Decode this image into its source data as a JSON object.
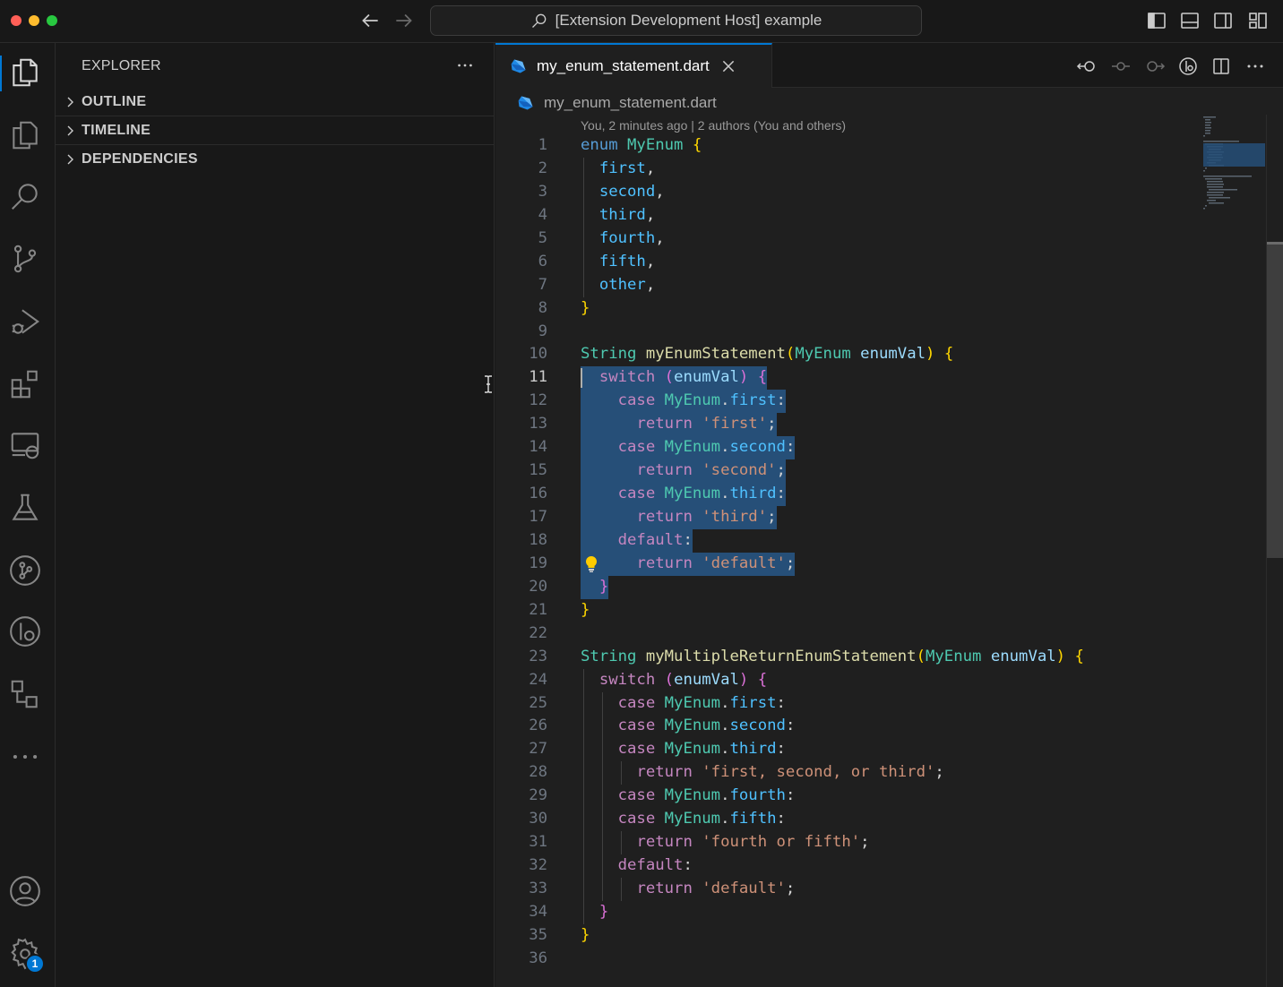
{
  "window": {
    "title": "[Extension Development Host] example"
  },
  "sidebar": {
    "title": "EXPLORER",
    "sections": [
      {
        "label": "OUTLINE"
      },
      {
        "label": "TIMELINE"
      },
      {
        "label": "DEPENDENCIES"
      }
    ]
  },
  "activity": {
    "settings_badge": "1"
  },
  "editor": {
    "tab_label": "my_enum_statement.dart",
    "breadcrumb": "my_enum_statement.dart",
    "codelens": "You, 2 minutes ago | 2 authors (You and others)",
    "current_line": 11,
    "lines": [
      {
        "n": "1",
        "t": "enum MyEnum {"
      },
      {
        "n": "2",
        "t": "  first,"
      },
      {
        "n": "3",
        "t": "  second,"
      },
      {
        "n": "4",
        "t": "  third,"
      },
      {
        "n": "5",
        "t": "  fourth,"
      },
      {
        "n": "6",
        "t": "  fifth,"
      },
      {
        "n": "7",
        "t": "  other,"
      },
      {
        "n": "8",
        "t": "}"
      },
      {
        "n": "9",
        "t": ""
      },
      {
        "n": "10",
        "t": "String myEnumStatement(MyEnum enumVal) {"
      },
      {
        "n": "11",
        "t": "  switch (enumVal) {"
      },
      {
        "n": "12",
        "t": "    case MyEnum.first:"
      },
      {
        "n": "13",
        "t": "      return 'first';"
      },
      {
        "n": "14",
        "t": "    case MyEnum.second:"
      },
      {
        "n": "15",
        "t": "      return 'second';"
      },
      {
        "n": "16",
        "t": "    case MyEnum.third:"
      },
      {
        "n": "17",
        "t": "      return 'third';"
      },
      {
        "n": "18",
        "t": "    default:"
      },
      {
        "n": "19",
        "t": "      return 'default';"
      },
      {
        "n": "20",
        "t": "  }"
      },
      {
        "n": "21",
        "t": "}"
      },
      {
        "n": "22",
        "t": ""
      },
      {
        "n": "23",
        "t": "String myMultipleReturnEnumStatement(MyEnum enumVal) {"
      },
      {
        "n": "24",
        "t": "  switch (enumVal) {"
      },
      {
        "n": "25",
        "t": "    case MyEnum.first:"
      },
      {
        "n": "26",
        "t": "    case MyEnum.second:"
      },
      {
        "n": "27",
        "t": "    case MyEnum.third:"
      },
      {
        "n": "28",
        "t": "      return 'first, second, or third';"
      },
      {
        "n": "29",
        "t": "    case MyEnum.fourth:"
      },
      {
        "n": "30",
        "t": "    case MyEnum.fifth:"
      },
      {
        "n": "31",
        "t": "      return 'fourth or fifth';"
      },
      {
        "n": "32",
        "t": "    default:"
      },
      {
        "n": "33",
        "t": "      return 'default';"
      },
      {
        "n": "34",
        "t": "  }"
      },
      {
        "n": "35",
        "t": "}"
      },
      {
        "n": "36",
        "t": ""
      }
    ]
  },
  "colors": {
    "accent": "#0078d4",
    "selection": "#264f78"
  }
}
